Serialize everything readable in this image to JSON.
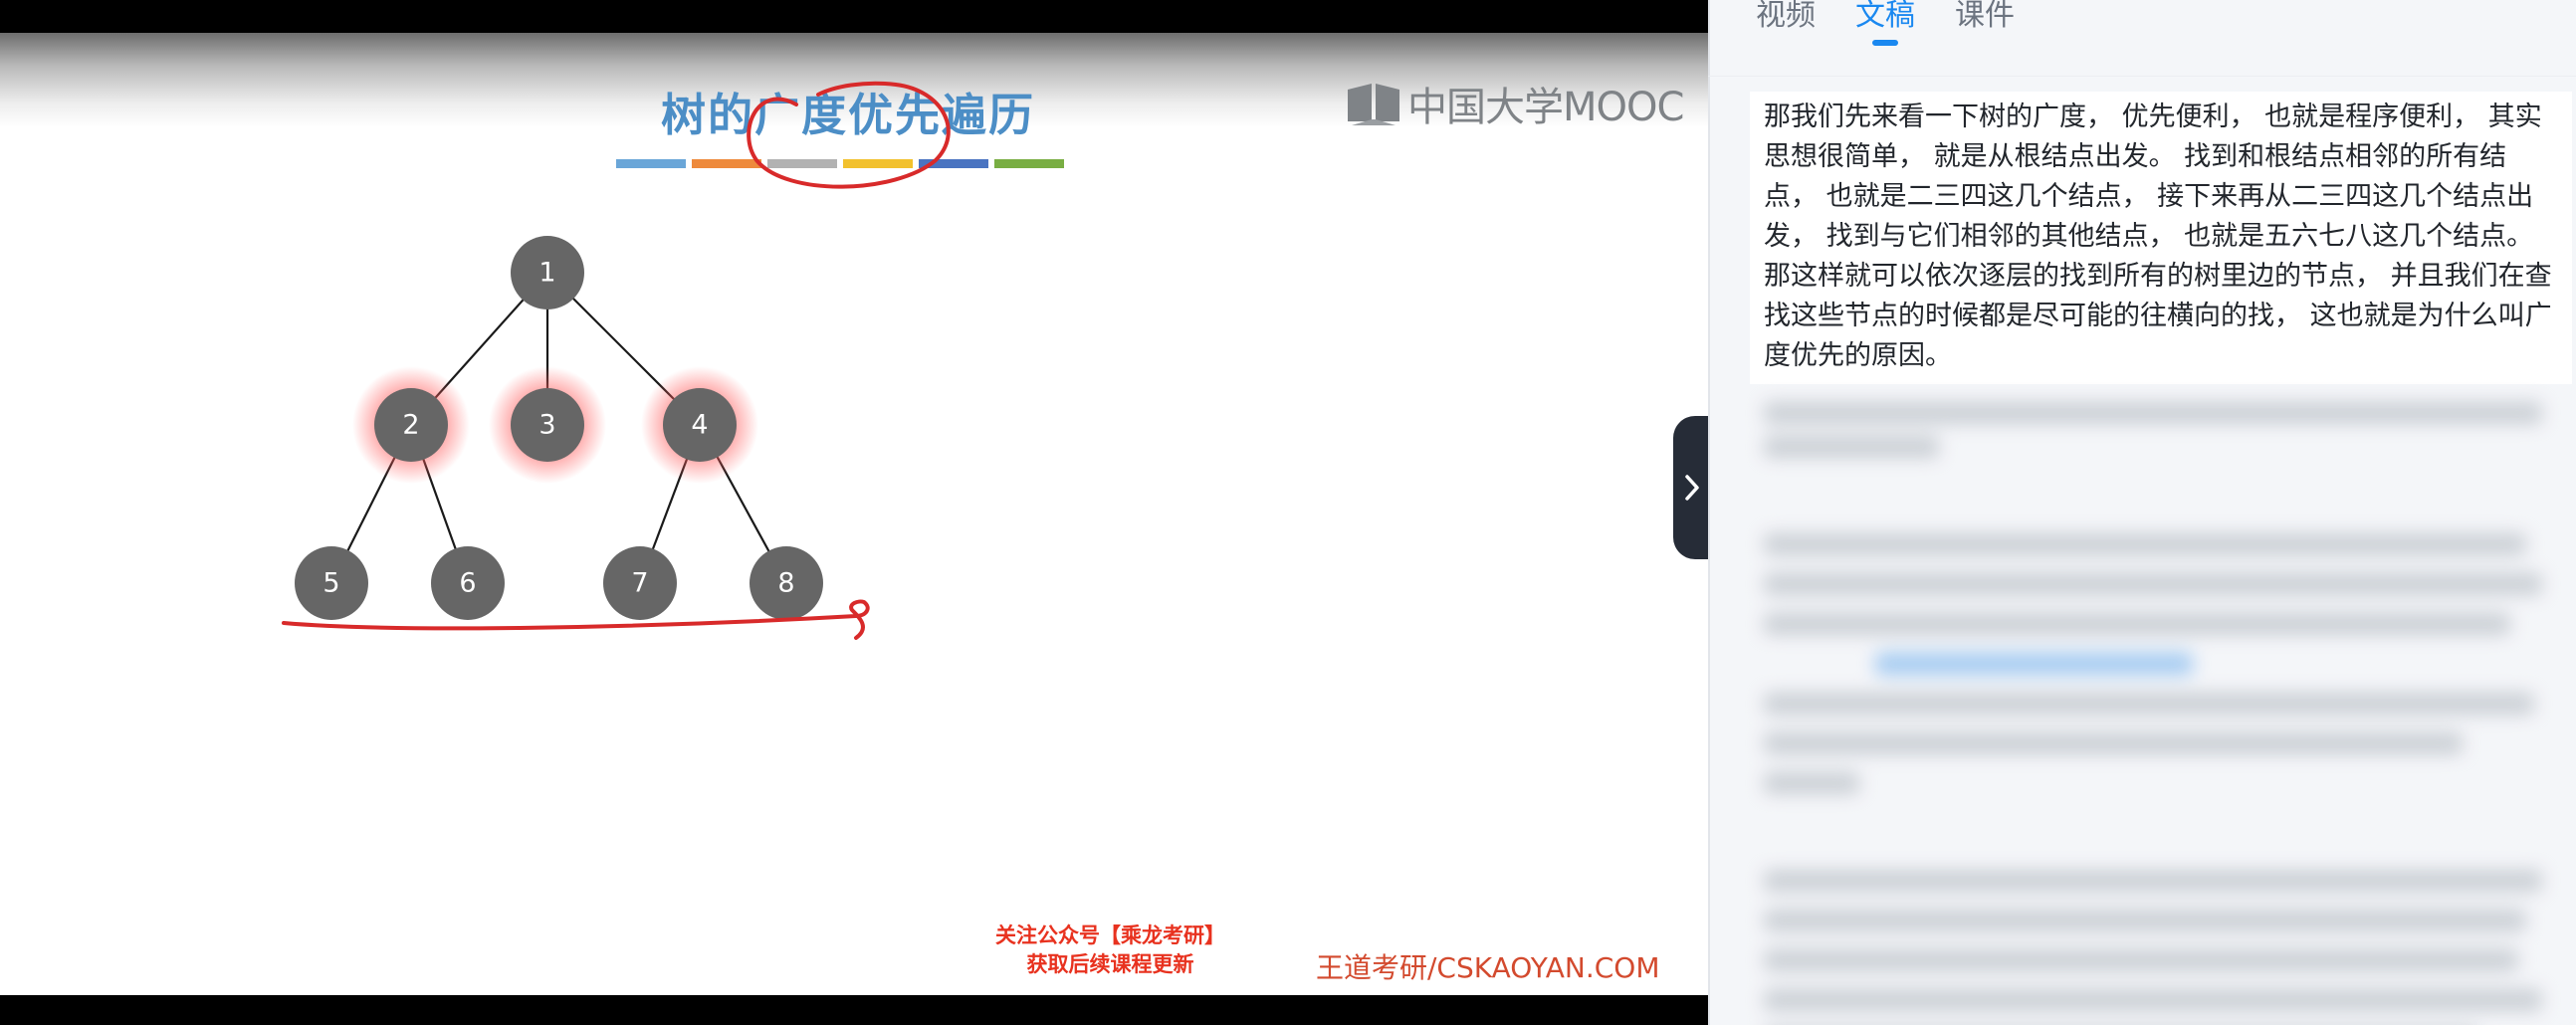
{
  "slide": {
    "title": "树的广度优先遍历",
    "bar_colors": [
      "#6aa6d8",
      "#ee8a3c",
      "#b2b2b2",
      "#f2c12d",
      "#4a74c1",
      "#79ae43"
    ],
    "logo_text": "中国大学MOOC",
    "promo_line1": "关注公众号【乘龙考研】",
    "promo_line2": "获取后续课程更新",
    "watermark": "王道考研/CSKAOYAN.COM",
    "nodes": [
      "1",
      "2",
      "3",
      "4",
      "5",
      "6",
      "7",
      "8"
    ],
    "node_color": "#666666",
    "glow_nodes": [
      "2",
      "3",
      "4"
    ],
    "annotation_color": "#d82a2a"
  },
  "player": {
    "expand_icon": "chevron-right-icon"
  },
  "panel": {
    "tabs": [
      {
        "label": "视频",
        "active": false
      },
      {
        "label": "文稿",
        "active": true
      },
      {
        "label": "课件",
        "active": false
      }
    ],
    "accent_color": "#1a88f0",
    "current_paragraph": "那我们先来看一下树的广度， 优先便利， 也就是程序便利， 其实思想很简单， 就是从根结点出发。 找到和根结点相邻的所有结点， 也就是二三四这几个结点， 接下来再从二三四这几个结点出发， 找到与它们相邻的其他结点， 也就是五六七八这几个结点。 那这样就可以依次逐层的找到所有的树里边的节点， 并且我们在查找这些节点的时候都是尽可能的往横向的找， 这也就是为什么叫广度优先的原因。"
  }
}
